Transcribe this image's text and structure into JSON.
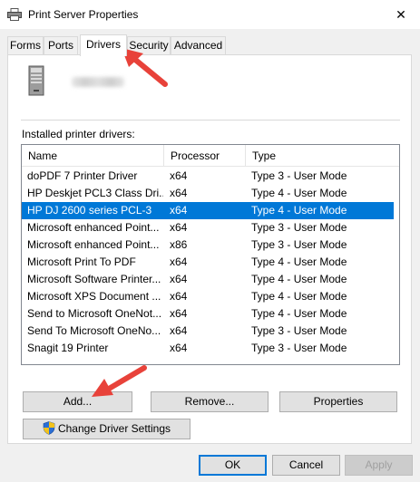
{
  "window": {
    "title": "Print Server Properties",
    "close_glyph": "✕"
  },
  "tabs": [
    {
      "label": "Forms",
      "active": false
    },
    {
      "label": "Ports",
      "active": false
    },
    {
      "label": "Drivers",
      "active": true
    },
    {
      "label": "Security",
      "active": false
    },
    {
      "label": "Advanced",
      "active": false
    }
  ],
  "drivers_tab": {
    "section_label": "Installed printer drivers:",
    "columns": [
      "Name",
      "Processor",
      "Type"
    ],
    "rows": [
      {
        "name": "doPDF 7 Printer Driver",
        "processor": "x64",
        "type": "Type 3 - User Mode",
        "selected": false
      },
      {
        "name": "HP Deskjet PCL3 Class Dri...",
        "processor": "x64",
        "type": "Type 4 - User Mode",
        "selected": false
      },
      {
        "name": "HP DJ 2600 series PCL-3",
        "processor": "x64",
        "type": "Type 4 - User Mode",
        "selected": true
      },
      {
        "name": "Microsoft enhanced Point...",
        "processor": "x64",
        "type": "Type 3 - User Mode",
        "selected": false
      },
      {
        "name": "Microsoft enhanced Point...",
        "processor": "x86",
        "type": "Type 3 - User Mode",
        "selected": false
      },
      {
        "name": "Microsoft Print To PDF",
        "processor": "x64",
        "type": "Type 4 - User Mode",
        "selected": false
      },
      {
        "name": "Microsoft Software Printer...",
        "processor": "x64",
        "type": "Type 4 - User Mode",
        "selected": false
      },
      {
        "name": "Microsoft XPS Document ...",
        "processor": "x64",
        "type": "Type 4 - User Mode",
        "selected": false
      },
      {
        "name": "Send to Microsoft OneNot...",
        "processor": "x64",
        "type": "Type 4 - User Mode",
        "selected": false
      },
      {
        "name": "Send To Microsoft OneNo...",
        "processor": "x64",
        "type": "Type 3 - User Mode",
        "selected": false
      },
      {
        "name": "Snagit 19 Printer",
        "processor": "x64",
        "type": "Type 3 - User Mode",
        "selected": false
      }
    ],
    "add_label": "Add...",
    "remove_label": "Remove...",
    "properties_label": "Properties",
    "change_settings_label": "Change Driver Settings"
  },
  "footer": {
    "ok_label": "OK",
    "cancel_label": "Cancel",
    "apply_label": "Apply"
  },
  "colors": {
    "selection": "#0078d7",
    "annotation_arrow": "#e8423a"
  },
  "icons": {
    "title": "printer-icon",
    "server": "server-tower-icon",
    "uac": "uac-shield-icon"
  }
}
